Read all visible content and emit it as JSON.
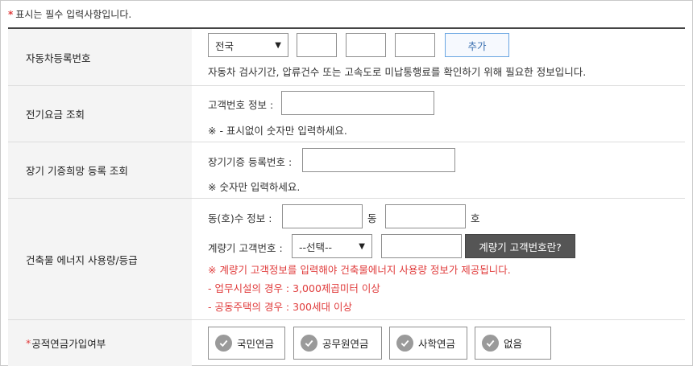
{
  "note": {
    "star": "*",
    "text": "표시는 필수 입력사항입니다."
  },
  "vehicle": {
    "label": "자동차등록번호",
    "region_selected": "전국",
    "add_button": "추가",
    "help": "자동차 검사기간, 압류건수 또는 고속도로 미납통행료를 확인하기 위해 필요한 정보입니다."
  },
  "electric": {
    "label": "전기요금 조회",
    "field_label": "고객번호 정보 :",
    "help": "※ - 표시없이 숫자만 입력하세요."
  },
  "organ": {
    "label": "장기 기증희망 등록 조회",
    "field_label": "장기기증 등록번호 :",
    "help": "※ 숫자만 입력하세요."
  },
  "building": {
    "label": "건축물 에너지 사용량/등급",
    "dong_label": "동(호)수 정보 :",
    "dong_suffix": "동",
    "ho_suffix": "호",
    "meter_label": "계량기 고객번호 :",
    "meter_select": "--선택--",
    "meter_button": "계량기 고객번호란?",
    "warn1": "※ 계량기 고객정보를 입력해야 건축물에너지 사용량 정보가 제공됩니다.",
    "warn2": "- 업무시설의 경우 : 3,000제곱미터 이상",
    "warn3": "- 공동주택의 경우 : 300세대 이상"
  },
  "pension": {
    "req": "*",
    "label": "공적연금가입여부",
    "options": [
      "국민연금",
      "공무원연금",
      "사학연금",
      "없음"
    ]
  },
  "colors": {
    "accent_red": "#e03c3c",
    "add_blue": "#6aa6e2",
    "dark_button": "#555555"
  }
}
